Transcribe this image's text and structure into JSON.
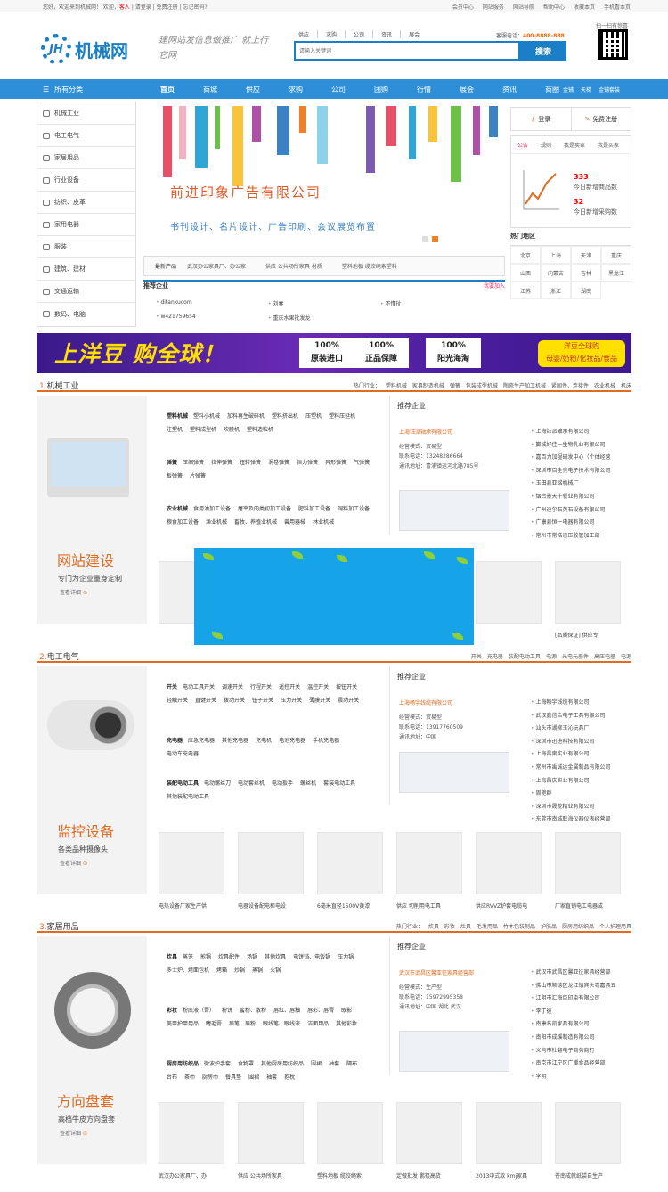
{
  "topbar": {
    "welcome": "您好，欢迎来到机械网！ 欢迎，",
    "guest": "客人",
    "links": "| 请登录 | 免费注册 | 忘记密码?",
    "right": [
      "会员中心",
      "网站服务",
      "网站导航",
      "帮助中心",
      "收藏本页",
      "手机看本页"
    ]
  },
  "header": {
    "logo_text": "机械网",
    "logo_mark": "JH",
    "slogan": "建网站发信息做推广 就上行它网",
    "search_tabs": [
      "供应",
      "求购",
      "公司",
      "资讯",
      "展会"
    ],
    "search_placeholder": "请输入关键词",
    "search_button": "搜索",
    "hotline_label": "客服电话：",
    "hotline": "400-8888-888",
    "qr_label": "扫一扫有惊喜"
  },
  "nav": {
    "all": "所有分类",
    "items": [
      "首页",
      "商城",
      "供应",
      "求购",
      "公司",
      "团购",
      "行情",
      "展会",
      "资讯",
      "商圈"
    ],
    "extra": [
      "金铺",
      "天梯",
      "金铺套装"
    ]
  },
  "categories": [
    "机械工业",
    "电工电气",
    "家居用品",
    "行业设备",
    "纺织、皮革",
    "家用电器",
    "服装",
    "建筑、建材",
    "交通运输",
    "数码、电脑"
  ],
  "banner": {
    "title": "前进印象广告有限公司",
    "subtitle": "书刊设计、名片设计、广告印刷、会议展览布置"
  },
  "new_products": {
    "label": "最新产品",
    "items": [
      "武汉办公家具厂、办公家",
      "供应 公共场所家具 材质",
      "塑料地板 缆绞绳索塑料"
    ]
  },
  "recommend": {
    "title": "推荐企业",
    "more": "我要加入",
    "items": [
      "ditankucom",
      "刘春",
      "不懂扯",
      "w421759654",
      "重庆水果批发龙"
    ]
  },
  "login": {
    "login": "登录",
    "register": "免费注册"
  },
  "notice": {
    "tabs": [
      "公告",
      "规则",
      "我是卖家",
      "我是买家"
    ],
    "stat1_num": "333",
    "stat1_label": "今日新增商品数",
    "stat2_num": "32",
    "stat2_label": "今日新增采购数"
  },
  "hot_area": {
    "title": "热门地区",
    "items": [
      "北京",
      "上海",
      "天津",
      "重庆",
      "山西",
      "内蒙古",
      "吉林",
      "黑龙江",
      "江苏",
      "浙江",
      "湖南"
    ]
  },
  "ad": {
    "title": "上洋豆 购全球！",
    "boxes": [
      [
        "100%",
        "原装进口"
      ],
      [
        "100%",
        "正品保障"
      ],
      [
        "100%",
        "阳光海淘"
      ]
    ],
    "tag1": "洋豆全球购",
    "tag2": "母婴/奶粉/化妆品/食品"
  },
  "sections": [
    {
      "num": "1.",
      "title": "机械工业",
      "hot_label": "热门行业：",
      "hot": [
        "塑料机械",
        "家具制造机械",
        "弹簧",
        "包装成型机械",
        "陶瓷生产加工机械",
        "紧固件、连接件",
        "农业机械",
        "机床"
      ],
      "promo_title": "网站建设",
      "promo_sub": "专门为企业量身定制",
      "promo_more": "查看详细",
      "cat_groups": [
        {
          "name": "塑料机械",
          "items": [
            "塑料小机械",
            "加料再生破碎机",
            "塑料挤出机",
            "压塑机",
            "塑料压延机",
            "注塑机",
            "塑料成型机",
            "吹膜机",
            "塑料造粒机"
          ]
        },
        {
          "name": "弹簧",
          "items": [
            "压缩弹簧",
            "拉伸弹簧",
            "扭转弹簧",
            "涡卷弹簧",
            "恒力弹簧",
            "异形弹簧",
            "气弹簧",
            "板弹簧",
            "片弹簧"
          ]
        },
        {
          "name": "农业机械",
          "items": [
            "食用油加工设备",
            "屠宰及肉类初加工设备",
            "肥料加工设备",
            "饲料加工设备",
            "粮食加工设备",
            "渔业机械",
            "畜牧、养殖业机械",
            "兽用器械",
            "林业机械"
          ]
        }
      ],
      "rec_title": "推荐企业",
      "company": "上海钰派轴承有限公司",
      "info": [
        "经营模式：贸易型",
        "联系电话：13248286664",
        "通讯地址：青浦镇运河北路785号"
      ],
      "list": [
        "上海钰派轴承有限公司",
        "鄞城好佳一生物乳业有限公司",
        "嘉百力加湿研发中心（个体经营",
        "深圳市百全亮电子技术有限公司",
        "玉田县亚铭机械厂",
        "烟台景天牛餐业有限公司",
        "广州迪尔石英石设备有限公司",
        "广康县恒一电器有限公司",
        "常州市常浩液压胶管加工部"
      ],
      "products": [
        "",
        "",
        "",
        "",
        "",
        "[品质保证] 供应专"
      ]
    },
    {
      "num": "2.",
      "title": "电工电气",
      "hot": [
        "开关",
        "充电器",
        "装配电动工具",
        "电源",
        "光电元器件",
        "高压电器",
        "电源"
      ],
      "promo_title": "监控设备",
      "promo_sub": "各类品种摄像头",
      "promo_more": "查看详细",
      "cat_groups": [
        {
          "name": "开关",
          "items": [
            "电动工具开关",
            "调速开关",
            "行程开关",
            "遥控开关",
            "温控开关",
            "按钮开关",
            "轻触开关",
            "直键开关",
            "拨动开关",
            "钮子开关",
            "压力开关",
            "薄膜开关",
            "震动开关"
          ]
        },
        {
          "name": "充电器",
          "items": [
            "应急充电器",
            "其他充电器",
            "充电机",
            "电池充电器",
            "手机充电器",
            "电动车充电器"
          ]
        },
        {
          "name": "装配电动工具",
          "items": [
            "电动螺丝刀",
            "电动套丝机",
            "电动扳手",
            "螺丝机",
            "套装电动工具",
            "其他装配电动工具"
          ]
        }
      ],
      "rec_title": "推荐企业",
      "company": "上海畅宇线缆有限公司",
      "info": [
        "经营模式：贸易型",
        "联系电话：13917760509",
        "通讯地址：中国"
      ],
      "list": [
        "上海畅宇线缆有限公司",
        "武汉鑫信合电子工具有限公司",
        "汕头市湖柳玉沁玩具厂",
        "深圳市迅进科技有限公司",
        "上海昌爽实业有限公司",
        "常州市禹诚达金属制品有限公司",
        "上海昌庆实业有限公司",
        "周艳群",
        "深圳市晟龙精业有限公司",
        "东莞市南城联海仪器仪表经营部"
      ],
      "products": [
        "电热设备厂家生产供",
        "电器设备配电柜电设",
        "6毫米直径1500V黄漆",
        "供应 切削用电工具",
        "供应RVVZ护套电缆电",
        "厂家直销电工电器成"
      ]
    },
    {
      "num": "3.",
      "title": "家居用品",
      "hot_label": "热门行业：",
      "hot": [
        "炊具",
        "彩妆",
        "灶具",
        "毛发用品",
        "竹木包装制品",
        "护肤品",
        "厨房用纺织品",
        "个人护理用具"
      ],
      "promo_title": "方向盘套",
      "promo_sub": "高档牛皮方向盘套",
      "promo_more": "查看详细",
      "cat_groups": [
        {
          "name": "炊具",
          "items": [
            "蒸笼",
            "煎锅",
            "炊具配件",
            "汤锅",
            "其他炊具",
            "电饼铛、电饭锅",
            "压力锅",
            "多士炉、烤面包机",
            "烤箱",
            "炒锅",
            "蒸锅",
            "火锅"
          ]
        },
        {
          "name": "彩妆",
          "items": [
            "粉底液（膏）",
            "粉饼",
            "蜜粉、散粉",
            "唇红、唇釉",
            "唇彩、唇膏",
            "眼影",
            "美甲护甲用品",
            "睫毛膏",
            "眉笔、眉粉",
            "眼线笔、眼线液",
            "洁面用品",
            "其他彩妆"
          ]
        },
        {
          "name": "厨房用纺织品",
          "items": [
            "微波炉手套",
            "食物罩",
            "其他厨房用纺织品",
            "围裙",
            "袖套",
            "隔布",
            "台布",
            "茶巾",
            "厨房巾",
            "餐具垫",
            "围裙",
            "袖套",
            "抱枕"
          ]
        }
      ],
      "rec_title": "推荐企业",
      "company": "武汉市武昌区馨亚征家具经营部",
      "info": [
        "经营模式：生产型",
        "联系电话：15972995358",
        "通讯地址：中国 湖北 武汉"
      ],
      "list": [
        "武汉市武昌区馨亚征家具经营部",
        "佛山市顺德区龙江镇宾头粤嘉具五",
        "江阴市汇海巨印染有限公司",
        "李丁彼",
        "南康名凯家具有限公司",
        "南阳市成蹊制造有限公司",
        "义乌市社翻电子商务商行",
        "南京市江宁区广潮食品经营部",
        "李明"
      ],
      "products": [
        "武汉办公家具厂、办",
        "供应 公共场所家具",
        "塑料地板 缆绞绳索",
        "定做批发 鹏筷高货",
        "2013中式款 kmj家具",
        "苍南成就纸袋自生产"
      ]
    }
  ],
  "colors": {
    "brand": "#1a7fc6",
    "nav": "#2e8fd8",
    "accent": "#e16b21",
    "search_button": "#1a7fc6"
  }
}
